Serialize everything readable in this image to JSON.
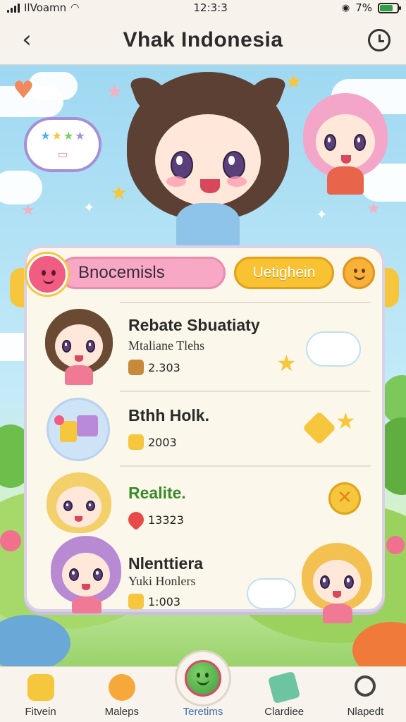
{
  "status_bar": {
    "carrier": "IlVoamn",
    "time": "12:3:3",
    "battery_text": "7%",
    "battery_level": 0.77
  },
  "header": {
    "title": "Vhak Indonesia"
  },
  "panel": {
    "search_label": "Bnocemisls",
    "action_label": "Uetighein"
  },
  "list": [
    {
      "title": "Rebate Sbuatiaty",
      "subtitle": "Mtaliane Tlehs",
      "count": "2.303"
    },
    {
      "title": "Bthh Holk.",
      "subtitle": "",
      "count": "2003"
    },
    {
      "title": "Realite.",
      "subtitle": "",
      "count": "13323"
    },
    {
      "title": "Nlenttiera",
      "subtitle": "Yuki Honlers",
      "count": "1:003"
    }
  ],
  "nav": [
    {
      "label": "Fitvein"
    },
    {
      "label": "Maleps"
    },
    {
      "label": "Teretims"
    },
    {
      "label": "Clardiee"
    },
    {
      "label": "Nlapedt"
    }
  ],
  "colors": {
    "accent_pink": "#f6a8c4",
    "accent_yellow": "#f8c232",
    "nav_active": "#3c6fb0"
  },
  "icons": [
    "back-arrow-icon",
    "history-icon",
    "wifi-icon",
    "battery-icon",
    "search-icon"
  ]
}
